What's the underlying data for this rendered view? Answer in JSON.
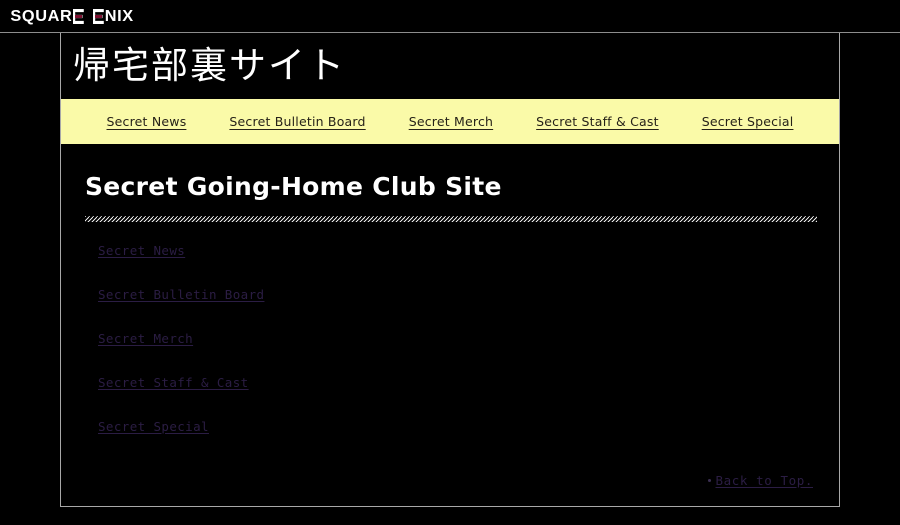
{
  "corporate": {
    "logo_text": "SQUARE ENIX",
    "logo_word_1": "SQUAR",
    "logo_word_2": "NIX",
    "accent_color": "#7d1030"
  },
  "banner": {
    "site_title": "帰宅部裏サイト"
  },
  "nav": {
    "items": [
      {
        "label": "Secret News"
      },
      {
        "label": "Secret Bulletin Board"
      },
      {
        "label": "Secret Merch"
      },
      {
        "label": "Secret Staff & Cast"
      },
      {
        "label": "Secret Special"
      }
    ],
    "background_color": "#fafaa8",
    "text_color": "#262218"
  },
  "main": {
    "page_title": "Secret Going-Home Club Site",
    "links": [
      {
        "label": "Secret News"
      },
      {
        "label": "Secret Bulletin Board"
      },
      {
        "label": "Secret Merch"
      },
      {
        "label": "Secret Staff & Cast"
      },
      {
        "label": "Secret Special"
      }
    ],
    "back_to_top": "Back to Top.",
    "link_color": "#2b1d44"
  }
}
